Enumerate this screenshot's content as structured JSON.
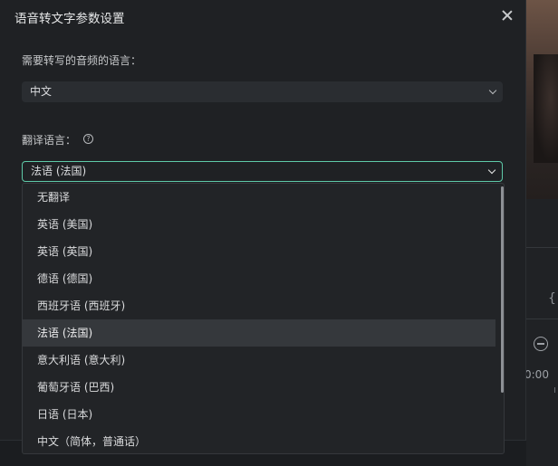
{
  "dialog": {
    "title": "语音转文字参数设置",
    "source_language_label": "需要转写的音频的语言：",
    "source_language_value": "中文",
    "translate_label": "翻译语言：",
    "help_icon": "question-circle-icon",
    "translate_value": "法语 (法国)"
  },
  "dropdown": {
    "options": [
      {
        "label": "无翻译"
      },
      {
        "label": "英语 (美国)"
      },
      {
        "label": "英语 (英国)"
      },
      {
        "label": "德语 (德国)"
      },
      {
        "label": "西班牙语 (西班牙)"
      },
      {
        "label": "法语 (法国)",
        "selected": true
      },
      {
        "label": "意大利语 (意大利)"
      },
      {
        "label": "葡萄牙语 (巴西)"
      },
      {
        "label": "日语 (日本)"
      },
      {
        "label": "中文（简体，普通话）"
      }
    ]
  },
  "background": {
    "brace": "{",
    "time": "0:00"
  },
  "colors": {
    "accent": "#5ec9a8",
    "dialog_bg": "#1f2124",
    "selected_bg": "#35383c"
  }
}
